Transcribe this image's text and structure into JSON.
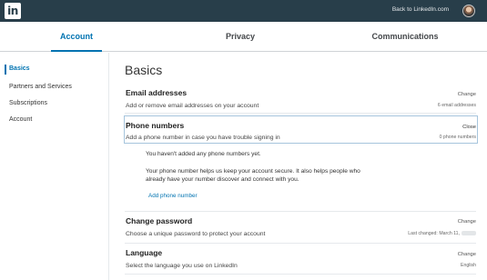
{
  "topbar": {
    "logo_text": "in",
    "back_link": "Back to LinkedIn.com"
  },
  "tabs": [
    {
      "label": "Account",
      "active": true
    },
    {
      "label": "Privacy",
      "active": false
    },
    {
      "label": "Communications",
      "active": false
    }
  ],
  "sidebar": {
    "items": [
      {
        "label": "Basics",
        "active": true
      },
      {
        "label": "Partners and Services",
        "active": false
      },
      {
        "label": "Subscriptions",
        "active": false
      },
      {
        "label": "Account",
        "active": false
      }
    ]
  },
  "main": {
    "title": "Basics",
    "sections": {
      "email": {
        "title": "Email addresses",
        "description": "Add or remove email addresses on your account",
        "action": "Change",
        "meta": "6 email addresses"
      },
      "phone": {
        "title": "Phone numbers",
        "description": "Add a phone number in case you have trouble signing in",
        "action": "Close",
        "meta": "0 phone numbers",
        "expanded": {
          "empty_text": "You haven't added any phone numbers yet.",
          "help_line1": "Your phone number helps us keep your account secure. It also helps people who",
          "help_line2": "already have your number discover and connect with you.",
          "add_link": "Add phone number"
        }
      },
      "password": {
        "title": "Change password",
        "description": "Choose a unique password to protect your account",
        "action": "Change",
        "meta": "Last changed: March 11,"
      },
      "language": {
        "title": "Language",
        "description": "Select the language you use on LinkedIn",
        "action": "Change",
        "meta": "English"
      }
    }
  },
  "colors": {
    "topbar": "#283e4a",
    "accent": "#0073b1",
    "divider": "#e6e9ec"
  }
}
